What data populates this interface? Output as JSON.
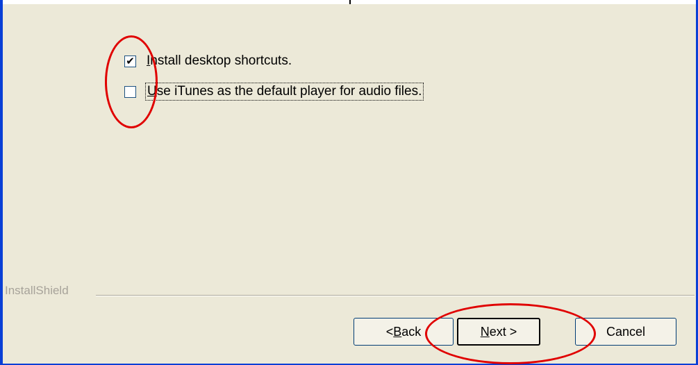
{
  "options": [
    {
      "label_prefix": "",
      "label_underlined": "I",
      "label_rest": "nstall desktop shortcuts.",
      "checked": true
    },
    {
      "label_prefix": "",
      "label_underlined": "U",
      "label_rest": "se iTunes as the default player for audio files.",
      "checked": false
    }
  ],
  "footer": {
    "brand": "InstallShield"
  },
  "buttons": {
    "back": {
      "prefix": "< ",
      "mnemonic": "B",
      "rest": "ack"
    },
    "next": {
      "prefix": "",
      "mnemonic": "N",
      "rest": "ext >"
    },
    "cancel": {
      "label": "Cancel"
    }
  },
  "annotation_color": "#e00000",
  "frame_color": "#0a3fd6"
}
